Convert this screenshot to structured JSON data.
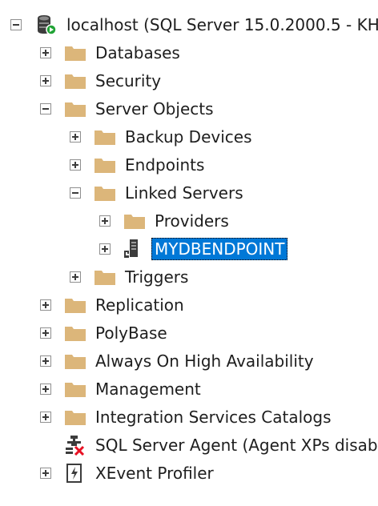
{
  "tree": {
    "root": {
      "label": "localhost (SQL Server 15.0.2000.5 - KH-",
      "icon": "database-server-icon",
      "state": "expanded"
    },
    "databases": {
      "label": "Databases",
      "icon": "folder-icon",
      "state": "collapsed"
    },
    "security": {
      "label": "Security",
      "icon": "folder-icon",
      "state": "collapsed"
    },
    "server_objects": {
      "label": "Server Objects",
      "icon": "folder-icon",
      "state": "expanded"
    },
    "backup_devices": {
      "label": "Backup Devices",
      "icon": "folder-icon",
      "state": "collapsed"
    },
    "endpoints": {
      "label": "Endpoints",
      "icon": "folder-icon",
      "state": "collapsed"
    },
    "linked_servers": {
      "label": "Linked Servers",
      "icon": "folder-icon",
      "state": "expanded"
    },
    "providers": {
      "label": "Providers",
      "icon": "folder-icon",
      "state": "collapsed"
    },
    "mydbendpoint": {
      "label": "MYDBENDPOINT",
      "icon": "linked-server-icon",
      "state": "collapsed",
      "selected": true
    },
    "triggers": {
      "label": "Triggers",
      "icon": "folder-icon",
      "state": "collapsed"
    },
    "replication": {
      "label": "Replication",
      "icon": "folder-icon",
      "state": "collapsed"
    },
    "polybase": {
      "label": "PolyBase",
      "icon": "folder-icon",
      "state": "collapsed"
    },
    "always_on": {
      "label": "Always On High Availability",
      "icon": "folder-icon",
      "state": "collapsed"
    },
    "management": {
      "label": "Management",
      "icon": "folder-icon",
      "state": "collapsed"
    },
    "integration_services": {
      "label": "Integration Services Catalogs",
      "icon": "folder-icon",
      "state": "collapsed"
    },
    "sql_server_agent": {
      "label": "SQL Server Agent (Agent XPs disab",
      "icon": "agent-disabled-icon",
      "state": "leaf"
    },
    "xevent_profiler": {
      "label": "XEvent Profiler",
      "icon": "xevent-profiler-icon",
      "state": "collapsed"
    }
  },
  "colors": {
    "folder": "#dcb67a",
    "selection": "#0078d7",
    "expander_border": "#8f8f8f",
    "agent_stop": "#e81123",
    "db_status": "#21a336"
  }
}
